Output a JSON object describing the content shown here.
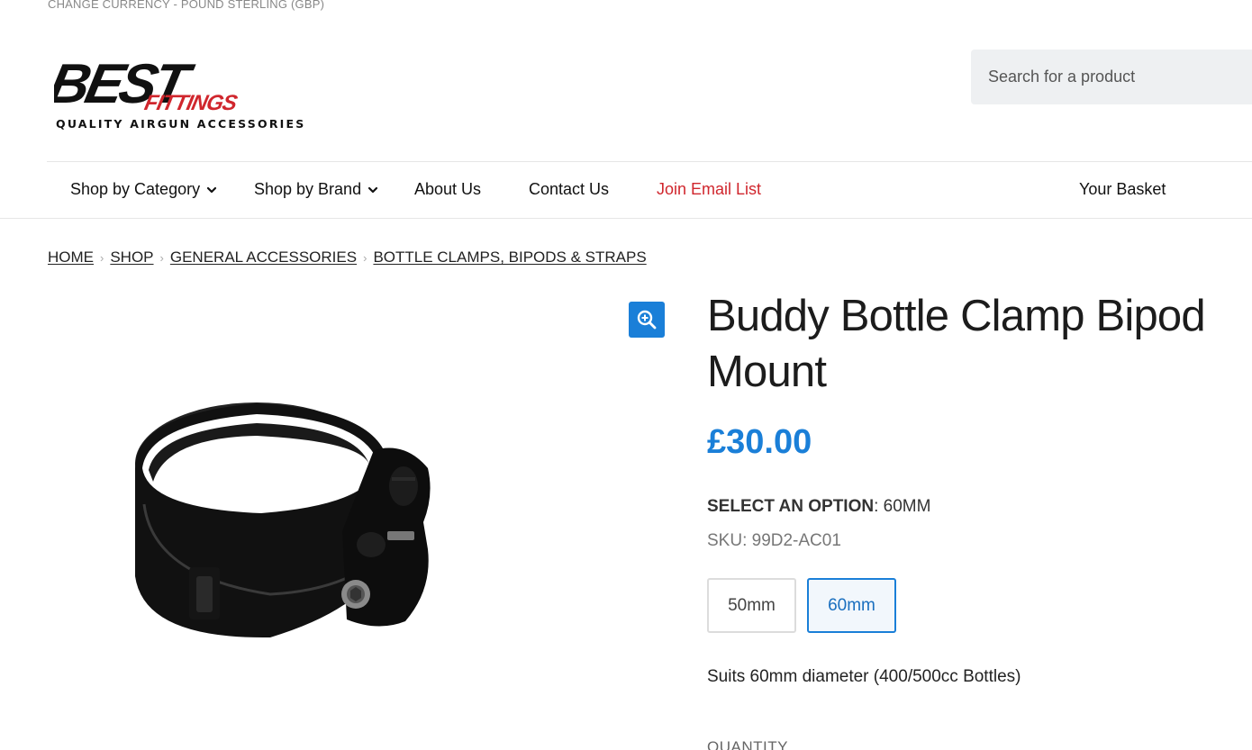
{
  "top": {
    "currency": "CHANGE CURRENCY - POUND STERLING (GBP)"
  },
  "logo": {
    "line1": "BEST",
    "line2": "FITTINGS",
    "tagline": "QUALITY AIRGUN ACCESSORIES"
  },
  "search": {
    "placeholder": "Search for a product"
  },
  "nav": {
    "items": [
      {
        "label": "Shop by Category"
      },
      {
        "label": "Shop by Brand"
      },
      {
        "label": "About Us"
      },
      {
        "label": "Contact Us"
      },
      {
        "label": "Join Email List"
      }
    ],
    "basket": "Your Basket"
  },
  "breadcrumb": [
    "HOME",
    "SHOP",
    "GENERAL ACCESSORIES",
    "BOTTLE CLAMPS, BIPODS & STRAPS"
  ],
  "product": {
    "title": "Buddy Bottle Clamp Bipod Mount",
    "price": "£30.00",
    "option_label": "SELECT AN OPTION",
    "option_value": ": 60MM",
    "sku": "SKU: 99D2-AC01",
    "options": [
      "50mm",
      "60mm"
    ],
    "description": "Suits 60mm diameter (400/500cc Bottles)",
    "quantity_label": "QUANTITY"
  },
  "colors": {
    "accent": "#1a7fd8",
    "brand_red": "#d0262d"
  }
}
